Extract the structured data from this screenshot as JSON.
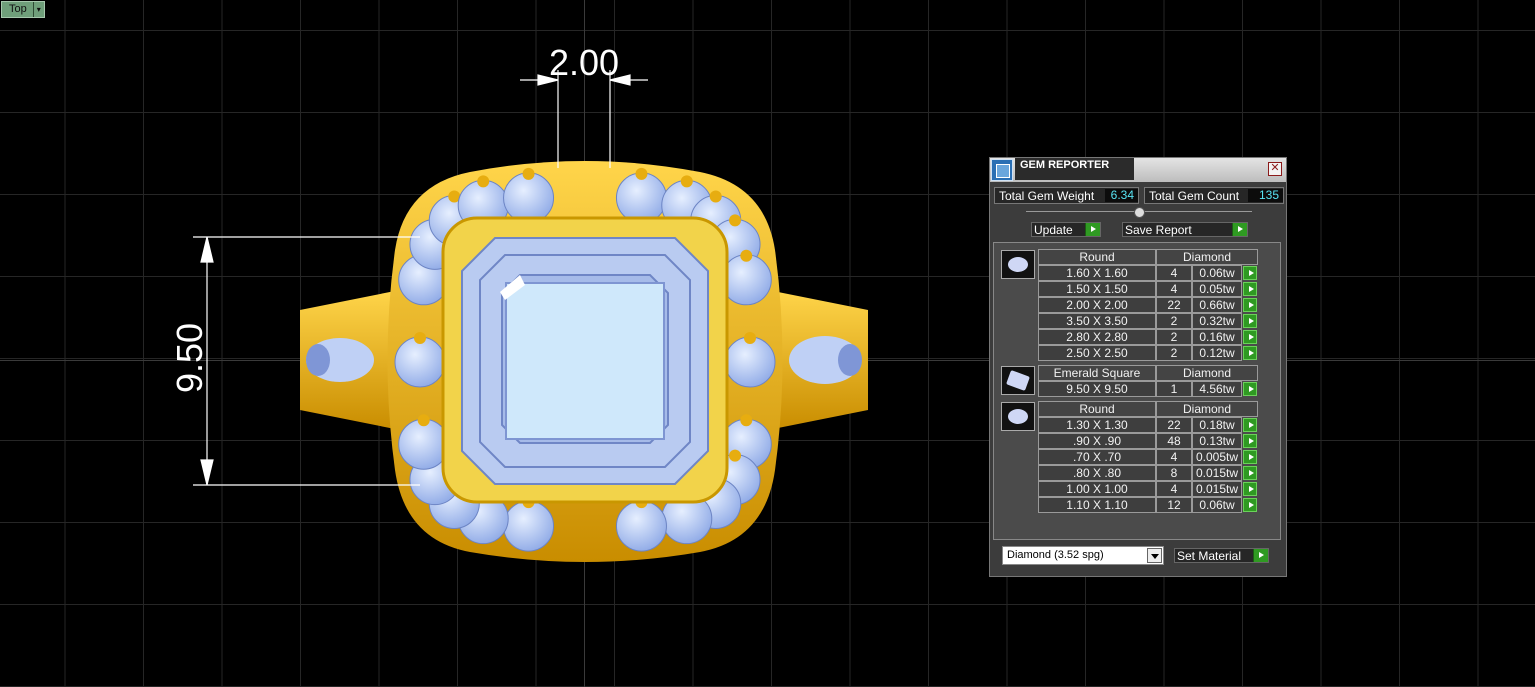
{
  "viewport": {
    "label": "Top"
  },
  "dimensions": {
    "top": "2.00",
    "left": "9.50"
  },
  "colors": {
    "gold": "#e8b10f",
    "diamond_fill": "#b9cbf1",
    "table_fill": "#cfe8fb",
    "gauge_value": "#58e4f4",
    "arrow_green": "#2f9a22"
  },
  "panel": {
    "title": "GEM REPORTER",
    "close_icon": "close-icon",
    "total_weight_label": "Total Gem Weight",
    "total_weight_value": "6.34",
    "total_count_label": "Total Gem Count",
    "total_count_value": "135",
    "update_label": "Update",
    "save_report_label": "Save Report",
    "groups": [
      {
        "icon": "round-gem-icon",
        "shape": "Round",
        "material": "Diamond",
        "rows": [
          {
            "size": "1.60 X 1.60",
            "count": "4",
            "weight": "0.06tw"
          },
          {
            "size": "1.50 X 1.50",
            "count": "4",
            "weight": "0.05tw"
          },
          {
            "size": "2.00 X 2.00",
            "count": "22",
            "weight": "0.66tw"
          },
          {
            "size": "3.50 X 3.50",
            "count": "2",
            "weight": "0.32tw"
          },
          {
            "size": "2.80 X 2.80",
            "count": "2",
            "weight": "0.16tw"
          },
          {
            "size": "2.50 X 2.50",
            "count": "2",
            "weight": "0.12tw"
          }
        ]
      },
      {
        "icon": "emerald-square-gem-icon",
        "shape": "Emerald Square",
        "material": "Diamond",
        "rows": [
          {
            "size": "9.50 X 9.50",
            "count": "1",
            "weight": "4.56tw"
          }
        ]
      },
      {
        "icon": "round-gem-icon",
        "shape": "Round",
        "material": "Diamond",
        "rows": [
          {
            "size": "1.30 X 1.30",
            "count": "22",
            "weight": "0.18tw"
          },
          {
            "size": ".90 X .90",
            "count": "48",
            "weight": "0.13tw"
          },
          {
            "size": ".70 X .70",
            "count": "4",
            "weight": "0.005tw"
          },
          {
            "size": ".80 X .80",
            "count": "8",
            "weight": "0.015tw"
          },
          {
            "size": "1.00 X 1.00",
            "count": "4",
            "weight": "0.015tw"
          },
          {
            "size": "1.10 X 1.10",
            "count": "12",
            "weight": "0.06tw"
          }
        ]
      }
    ],
    "material_select": "Diamond     (3.52 spg)",
    "set_material_label": "Set Material"
  }
}
